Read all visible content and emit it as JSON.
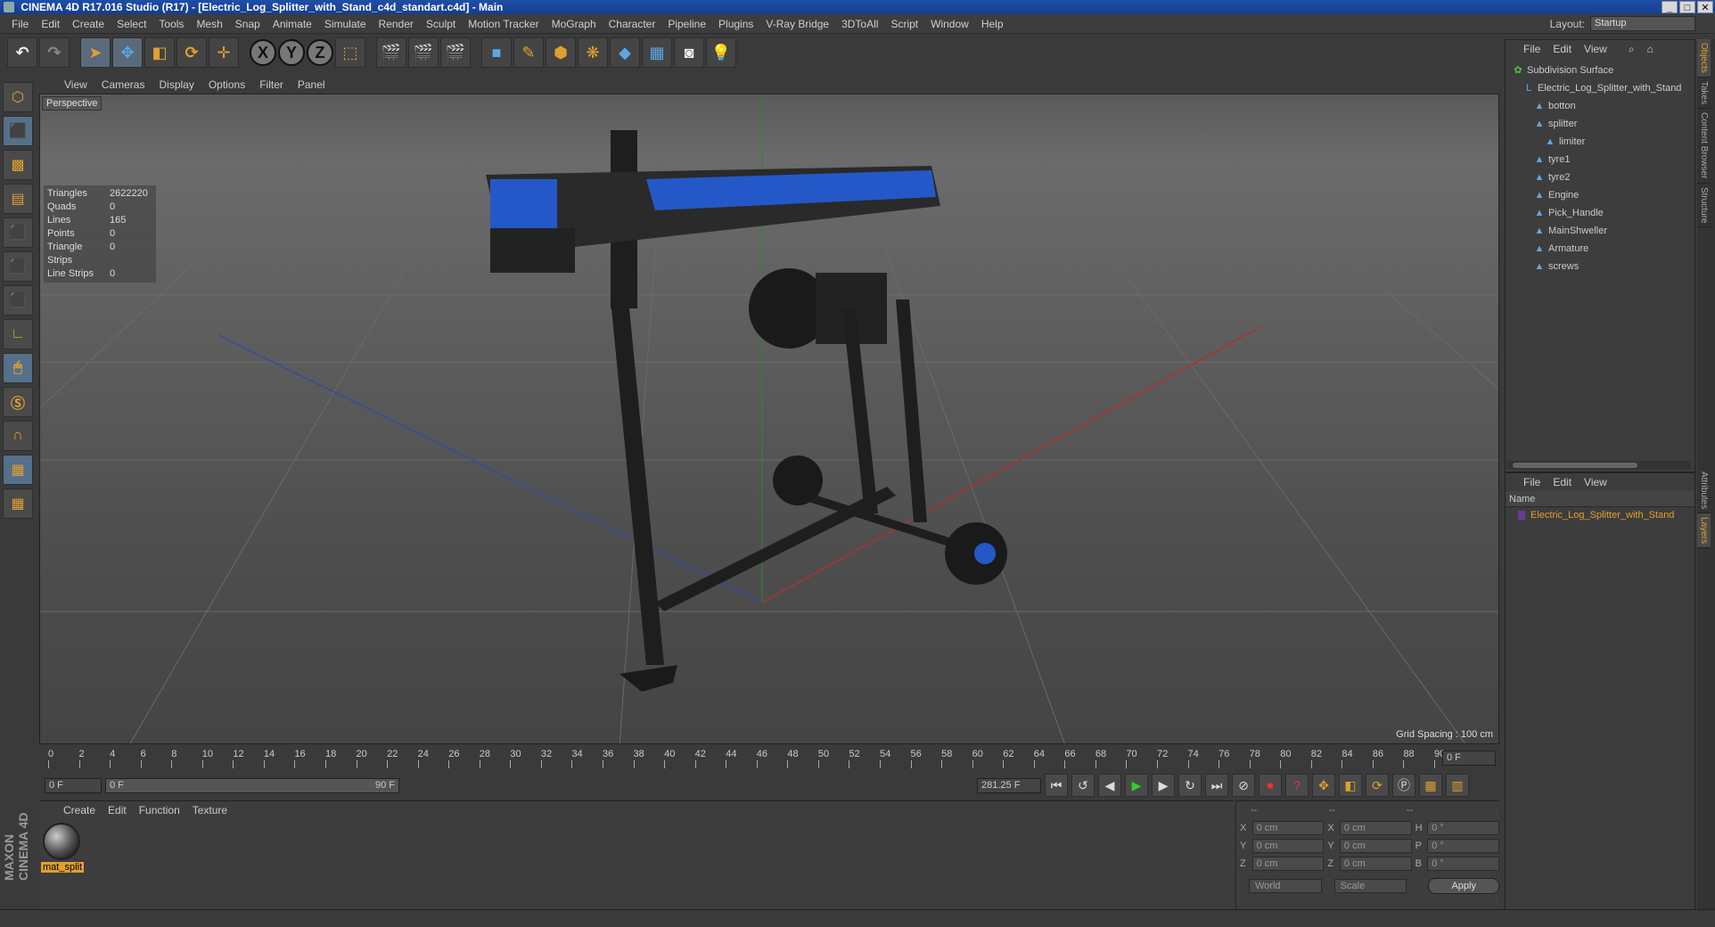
{
  "window": {
    "title": "CINEMA 4D R17.016 Studio (R17) - [Electric_Log_Splitter_with_Stand_c4d_standart.c4d] - Main",
    "buttons": [
      "_",
      "□",
      "✕"
    ]
  },
  "menubar": {
    "items": [
      "File",
      "Edit",
      "Create",
      "Select",
      "Tools",
      "Mesh",
      "Snap",
      "Animate",
      "Simulate",
      "Render",
      "Sculpt",
      "Motion Tracker",
      "MoGraph",
      "Character",
      "Pipeline",
      "Plugins",
      "V-Ray Bridge",
      "3DToAll",
      "Script",
      "Window",
      "Help"
    ],
    "layout_label": "Layout:",
    "layout_value": "Startup"
  },
  "toolbar": {
    "axis": [
      "X",
      "Y",
      "Z"
    ]
  },
  "viewport": {
    "menu": [
      "View",
      "Cameras",
      "Display",
      "Options",
      "Filter",
      "Panel"
    ],
    "label": "Perspective",
    "stats": [
      {
        "k": "Triangles",
        "v": "2622220"
      },
      {
        "k": "Quads",
        "v": "0"
      },
      {
        "k": "Lines",
        "v": "165"
      },
      {
        "k": "Points",
        "v": "0"
      },
      {
        "k": "Triangle Strips",
        "v": "0"
      },
      {
        "k": "Line Strips",
        "v": "0"
      }
    ],
    "grid_spacing": "Grid Spacing : 100 cm"
  },
  "timeline": {
    "ticks": [
      "0",
      "2",
      "4",
      "6",
      "8",
      "10",
      "12",
      "14",
      "16",
      "18",
      "20",
      "22",
      "24",
      "26",
      "28",
      "30",
      "32",
      "34",
      "36",
      "38",
      "40",
      "42",
      "44",
      "46",
      "48",
      "50",
      "52",
      "54",
      "56",
      "58",
      "60",
      "62",
      "64",
      "66",
      "68",
      "70",
      "72",
      "74",
      "76",
      "78",
      "80",
      "82",
      "84",
      "86",
      "88",
      "90"
    ],
    "current": "0 F"
  },
  "transport": {
    "start": "0 F",
    "slider_left": "0 F",
    "slider_right": "90 F",
    "end": "281.25 F"
  },
  "material": {
    "menu": [
      "Create",
      "Edit",
      "Function",
      "Texture"
    ],
    "name": "mat_split"
  },
  "coords": {
    "headers": [
      "--",
      "--",
      "--"
    ],
    "rows": [
      {
        "a": "X",
        "av": "0 cm",
        "b": "X",
        "bv": "0 cm",
        "c": "H",
        "cv": "0 °"
      },
      {
        "a": "Y",
        "av": "0 cm",
        "b": "Y",
        "bv": "0 cm",
        "c": "P",
        "cv": "0 °"
      },
      {
        "a": "Z",
        "av": "0 cm",
        "b": "Z",
        "bv": "0 cm",
        "c": "B",
        "cv": "0 °"
      }
    ],
    "world": "World",
    "scale": "Scale",
    "apply": "Apply"
  },
  "objects": {
    "menu": [
      "File",
      "Edit",
      "View"
    ],
    "tree": [
      {
        "label": "Subdivision Surface",
        "depth": 0,
        "icon": "green"
      },
      {
        "label": "Electric_Log_Splitter_with_Stand",
        "depth": 1,
        "icon": "null"
      },
      {
        "label": "botton",
        "depth": 2,
        "icon": "bone"
      },
      {
        "label": "splitter",
        "depth": 2,
        "icon": "bone"
      },
      {
        "label": "limiter",
        "depth": 3,
        "icon": "bone"
      },
      {
        "label": "tyre1",
        "depth": 2,
        "icon": "bone"
      },
      {
        "label": "tyre2",
        "depth": 2,
        "icon": "bone"
      },
      {
        "label": "Engine",
        "depth": 2,
        "icon": "bone"
      },
      {
        "label": "Pick_Handle",
        "depth": 2,
        "icon": "bone"
      },
      {
        "label": "MainShweller",
        "depth": 2,
        "icon": "bone"
      },
      {
        "label": "Armature",
        "depth": 2,
        "icon": "bone"
      },
      {
        "label": "screws",
        "depth": 2,
        "icon": "bone"
      }
    ]
  },
  "layers": {
    "menu": [
      "File",
      "Edit",
      "View"
    ],
    "header": "Name",
    "item": "Electric_Log_Splitter_with_Stand"
  },
  "sidetabs": [
    "Objects",
    "Takes",
    "Content Browser",
    "Structure",
    "Attributes",
    "Layers"
  ]
}
